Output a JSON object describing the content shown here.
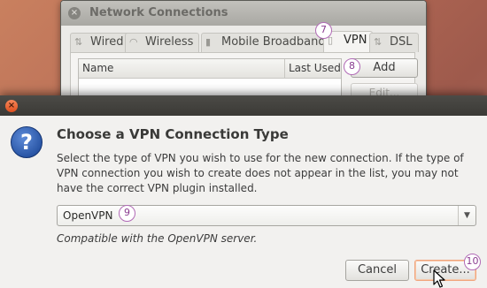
{
  "background_window": {
    "title": "Network Connections",
    "tabs": [
      {
        "label": "Wired",
        "icon": "wired-icon"
      },
      {
        "label": "Wireless",
        "icon": "wireless-icon"
      },
      {
        "label": "Mobile Broadband",
        "icon": "mobile-broadband-icon"
      },
      {
        "label": "VPN",
        "icon": "vpn-lock-icon",
        "active": true
      },
      {
        "label": "DSL",
        "icon": "dsl-icon"
      }
    ],
    "table_headers": {
      "name": "Name",
      "last_used": "Last Used"
    },
    "buttons": {
      "add": "Add",
      "edit": "Edit..."
    }
  },
  "markers": {
    "tab_vpn": "7",
    "add": "8",
    "combo": "9",
    "create": "10"
  },
  "dialog": {
    "heading": "Choose a VPN Connection Type",
    "description": "Select the type of VPN you wish to use for the new connection.  If the type of VPN connection you wish to create does not appear in the list, you may not have the correct VPN plugin installed.",
    "vpn_type": {
      "selected": "OpenVPN"
    },
    "compat_note": "Compatible with the OpenVPN server.",
    "buttons": {
      "cancel": "Cancel",
      "create": "Create..."
    }
  },
  "colors": {
    "marker": "#b16ab6",
    "focus": "#f0a57e",
    "dialog_titlebar": "#3b3a36"
  }
}
